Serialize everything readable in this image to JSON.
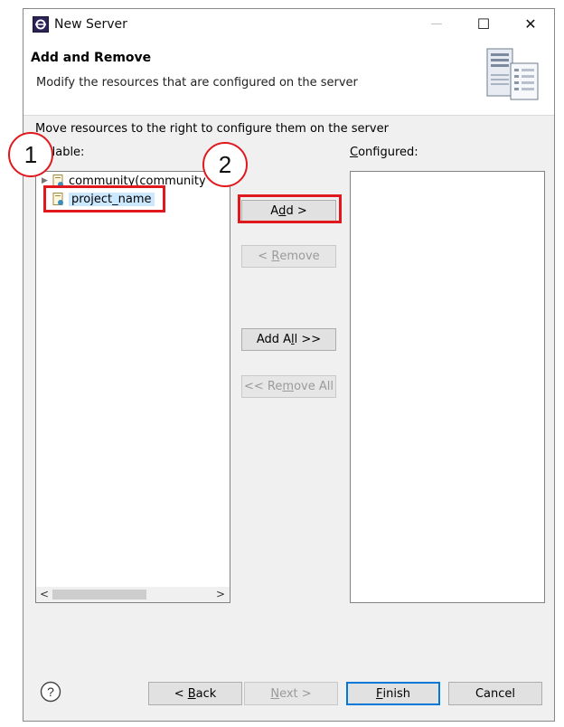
{
  "window": {
    "title": "New Server",
    "controls": {
      "minimize": "—",
      "maximize": "☐",
      "close": "✕"
    }
  },
  "header": {
    "title": "Add and Remove",
    "description": "Modify the resources that are configured on the server"
  },
  "instruction": "Move resources to the right to configure them on the server",
  "available": {
    "label": "Available:",
    "label_visible": "ilable:",
    "items": [
      {
        "label": "community(community"
      },
      {
        "label": "project_name"
      }
    ]
  },
  "configured": {
    "label_prefix": "",
    "label_mnemonic": "C",
    "label_rest": "onfigured:",
    "items": []
  },
  "buttons": {
    "add": {
      "pre": "A",
      "mn": "d",
      "post": "d >"
    },
    "remove": {
      "pre": "< ",
      "mn": "R",
      "post": "emove"
    },
    "add_all": {
      "pre": "Add A",
      "mn": "l",
      "post": "l >>"
    },
    "remove_all": {
      "pre": "<< Re",
      "mn": "m",
      "post": "ove All"
    },
    "back": {
      "pre": "< ",
      "mn": "B",
      "post": "ack"
    },
    "next": {
      "pre": "",
      "mn": "N",
      "post": "ext >"
    },
    "finish": {
      "pre": "",
      "mn": "F",
      "post": "inish"
    },
    "cancel": "Cancel"
  },
  "annotations": {
    "step1": "1",
    "step2": "2"
  },
  "colors": {
    "highlight": "#e0191e",
    "selection": "#cce8ff",
    "default_button": "#0078d7"
  }
}
